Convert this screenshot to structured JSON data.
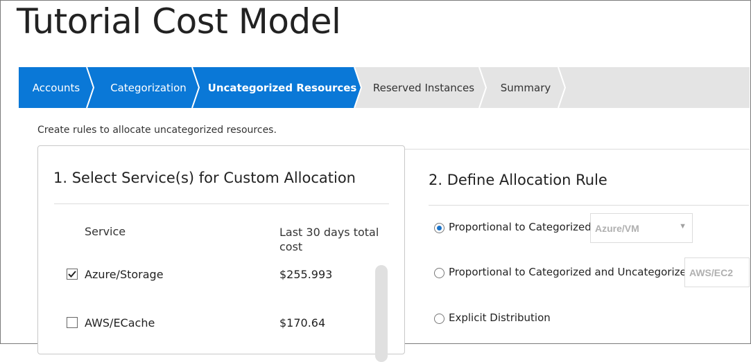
{
  "page": {
    "title": "Tutorial Cost Model"
  },
  "wizard": {
    "steps": [
      {
        "label": "Accounts",
        "state": "done"
      },
      {
        "label": "Categorization",
        "state": "done"
      },
      {
        "label": "Uncategorized Resources",
        "state": "current"
      },
      {
        "label": "Reserved Instances",
        "state": "pending"
      },
      {
        "label": "Summary",
        "state": "pending"
      }
    ],
    "colors": {
      "active": "#0a78d7",
      "inactive": "#e4e4e4",
      "separator": "#ffffff"
    }
  },
  "intro": "Create rules to allocate uncategorized resources.",
  "left_panel": {
    "title": "1. Select Service(s) for Custom Allocation",
    "columns": {
      "service": "Service",
      "cost": "Last 30 days total cost"
    },
    "rows": [
      {
        "service": "Azure/Storage",
        "cost": "$255.993",
        "checked": true
      },
      {
        "service": "AWS/ECache",
        "cost": "$170.64",
        "checked": false
      }
    ]
  },
  "right_panel": {
    "title": "2. Define Allocation Rule",
    "options": [
      {
        "label": "Proportional to Categorized",
        "selected": true,
        "select_value": "Azure/VM"
      },
      {
        "label": "Proportional to Categorized and Uncategorized",
        "selected": false,
        "select_value": "AWS/EC2"
      },
      {
        "label": "Explicit Distribution",
        "selected": false
      }
    ]
  }
}
